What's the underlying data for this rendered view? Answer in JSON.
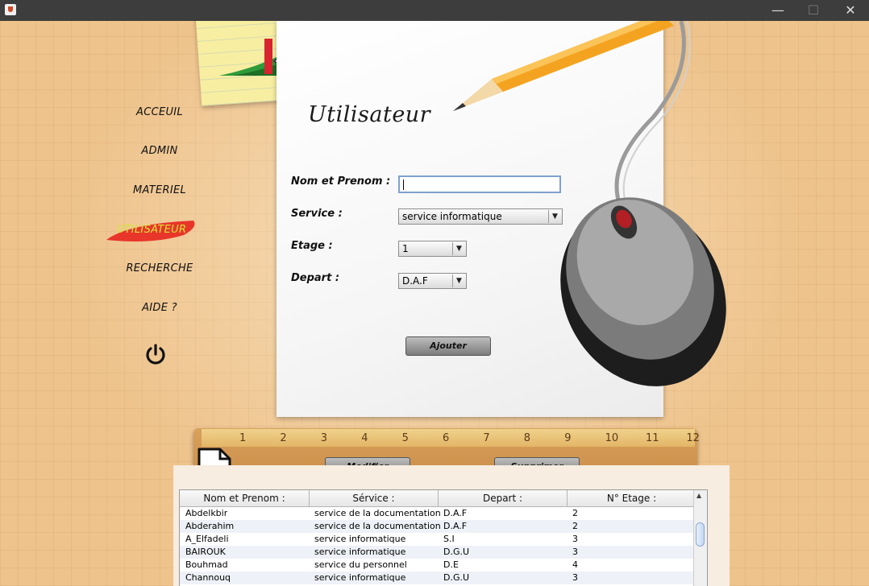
{
  "window": {
    "minimize_glyph": "—",
    "maximize_glyph": "☐",
    "close_glyph": "✕"
  },
  "nav": {
    "items": [
      {
        "label": "ACCEUIL"
      },
      {
        "label": "ADMIN"
      },
      {
        "label": "MATERIEL"
      },
      {
        "label": "UTILISATEUR",
        "active": true
      },
      {
        "label": "RECHERCHE"
      },
      {
        "label": "AIDE ?"
      }
    ],
    "power_icon": "power-icon"
  },
  "form": {
    "title": "Utilisateur",
    "name_label": "Nom et Prenom :",
    "name_value": "",
    "service_label": "Service :",
    "service_value": "service informatique",
    "etage_label": "Etage :",
    "etage_value": "1",
    "depart_label": "Depart :",
    "depart_value": "D.A.F",
    "add_button": "Ajouter"
  },
  "ruler": {
    "ticks": [
      "1",
      "2",
      "3",
      "4",
      "5",
      "6",
      "7",
      "8",
      "9",
      "10",
      "11",
      "12"
    ],
    "modify_button": "Modifier",
    "delete_button": "Supprimer",
    "pdf_icon": "pdf-icon"
  },
  "table": {
    "columns": [
      "Nom et Prenom :",
      "Sérvice :",
      "Depart :",
      "N° Etage :"
    ],
    "rows": [
      [
        "Abdelkbir",
        "service de la documentation",
        "D.A.F",
        "2"
      ],
      [
        "Abderahim",
        "service de la documentation",
        "D.A.F",
        "2"
      ],
      [
        "A_Elfadeli",
        "service informatique",
        "S.I",
        "3"
      ],
      [
        "BAIROUK",
        "service informatique",
        "D.G.U",
        "3"
      ],
      [
        "Bouhmad",
        "service du personnel",
        "D.E",
        "4"
      ],
      [
        "Channouq",
        "service informatique",
        "D.G.U",
        "3"
      ]
    ]
  },
  "colors": {
    "active_nav": "#d6e436",
    "brush": "#e8362a",
    "input_border": "#7da2ce"
  }
}
